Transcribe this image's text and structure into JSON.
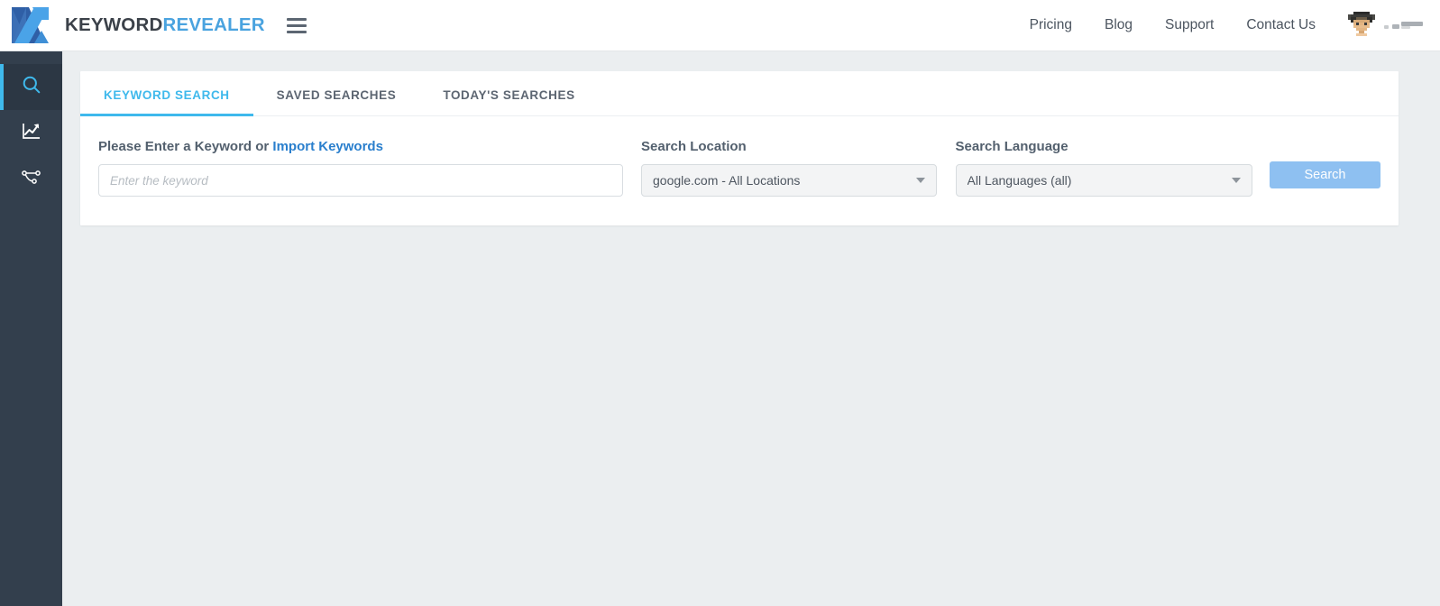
{
  "header": {
    "brand": {
      "part1": "KEYWORD",
      "part2": "REVEALER"
    },
    "menu_icon": "hamburger-icon",
    "nav": [
      {
        "label": "Pricing"
      },
      {
        "label": "Blog"
      },
      {
        "label": "Support"
      },
      {
        "label": "Contact Us"
      }
    ],
    "user": {
      "avatar_icon": "user-avatar",
      "username": ""
    }
  },
  "sidebar": {
    "items": [
      {
        "name": "keyword-search",
        "icon": "search-icon",
        "active": true
      },
      {
        "name": "rank-tracker",
        "icon": "chart-line-icon",
        "active": false
      },
      {
        "name": "backlinks",
        "icon": "network-nodes-icon",
        "active": false
      }
    ]
  },
  "main": {
    "tabs": [
      {
        "label": "KEYWORD SEARCH",
        "active": true
      },
      {
        "label": "SAVED SEARCHES",
        "active": false
      },
      {
        "label": "TODAY'S SEARCHES",
        "active": false
      }
    ],
    "keyword_field": {
      "label_prefix": "Please Enter a Keyword or ",
      "import_link": "Import Keywords",
      "placeholder": "Enter the keyword",
      "value": ""
    },
    "location_field": {
      "label": "Search Location",
      "selected": "google.com - All Locations"
    },
    "language_field": {
      "label": "Search Language",
      "selected": "All Languages (all)"
    },
    "search_button": {
      "label": "Search"
    }
  },
  "colors": {
    "accent_blue": "#3fb9ec",
    "link_blue": "#2a7fcd",
    "sidebar_dark": "#333f4d",
    "page_bg": "#ebeef0",
    "button_blue": "#8ec0f1"
  }
}
